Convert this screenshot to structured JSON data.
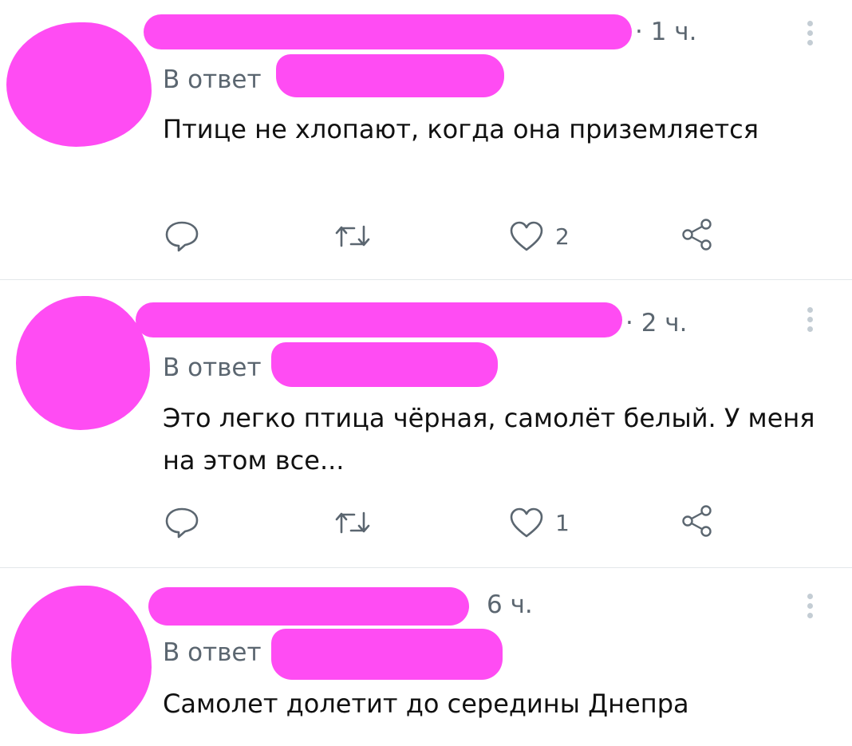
{
  "colors": {
    "redaction": "#ff4cf3",
    "muted": "#5b6670",
    "text": "#111111",
    "divider": "#e3e7ea"
  },
  "tweets": [
    {
      "time": "· 1 ч.",
      "reply_to": "В ответ",
      "text": "Птице не хлопают, когда она приземляется",
      "likes": "2"
    },
    {
      "time": "· 2 ч.",
      "reply_to": "В ответ",
      "text": "Это легко птица чёрная, самолёт белый. У меня на этом все...",
      "likes": "1"
    },
    {
      "time": "6 ч.",
      "reply_to": "В ответ",
      "text": "Самолет долетит до середины Днепра",
      "likes": ""
    }
  ],
  "icons": {
    "reply": "reply-icon",
    "retweet": "retweet-icon",
    "like": "heart-icon",
    "share": "share-icon",
    "menu": "more-vertical-icon"
  }
}
